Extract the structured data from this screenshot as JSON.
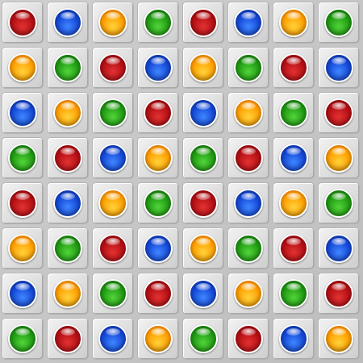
{
  "board": {
    "rows": 8,
    "cols": 8,
    "grid": [
      [
        "red",
        "blue",
        "orange",
        "green",
        "red",
        "blue",
        "orange",
        "green"
      ],
      [
        "orange",
        "green",
        "red",
        "blue",
        "orange",
        "green",
        "red",
        "blue"
      ],
      [
        "blue",
        "orange",
        "green",
        "red",
        "blue",
        "orange",
        "green",
        "red"
      ],
      [
        "green",
        "red",
        "blue",
        "orange",
        "green",
        "red",
        "blue",
        "orange"
      ],
      [
        "red",
        "blue",
        "orange",
        "green",
        "red",
        "blue",
        "orange",
        "green"
      ],
      [
        "orange",
        "green",
        "red",
        "blue",
        "orange",
        "green",
        "red",
        "blue"
      ],
      [
        "blue",
        "orange",
        "green",
        "red",
        "blue",
        "orange",
        "green",
        "red"
      ],
      [
        "green",
        "red",
        "blue",
        "orange",
        "green",
        "red",
        "blue",
        "orange"
      ]
    ]
  },
  "colors": {
    "red": "#b40f14",
    "blue": "#1447d6",
    "orange": "#ff9f00",
    "green": "#1f9a12",
    "tile": "#e2e2e2"
  }
}
